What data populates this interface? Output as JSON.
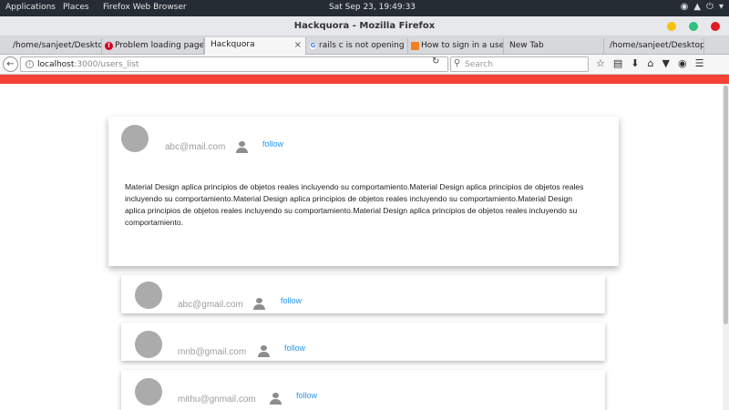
{
  "topbar": {
    "applications": "Applications",
    "places": "Places",
    "app_name": "Firefox Web Browser",
    "clock": "Sat Sep 23, 19:49:33",
    "icons": [
      "network-icon",
      "volume-icon",
      "power-icon",
      "chevron-down-icon"
    ]
  },
  "window": {
    "title": "Hackquora - Mozilla Firefox",
    "button_colors": [
      "#f5c211",
      "#2ec27e",
      "#e01b24"
    ]
  },
  "tabs": [
    {
      "label": "/home/sanjeet/Desktop/D",
      "favicon": "none"
    },
    {
      "label": "Problem loading page",
      "favicon": "error"
    },
    {
      "label": "Hackquora",
      "favicon": "none",
      "active": true
    },
    {
      "label": "rails c is not opening",
      "favicon": "google"
    },
    {
      "label": "How to sign in a user",
      "favicon": "stackoverflow"
    },
    {
      "label": "New Tab",
      "favicon": "none"
    },
    {
      "label": "/home/sanjeet/Desktop/D",
      "favicon": "none"
    }
  ],
  "navbar": {
    "url_host": "localhost",
    "url_path": ":3000/users_list",
    "search_placeholder": "Search"
  },
  "colors": {
    "accent_red": "#f44336",
    "link_blue": "#2196f3",
    "avatar_gray": "#ababab"
  },
  "main_card": {
    "email": "abc@mail.com",
    "follow_label": "follow",
    "description": "Material Design aplica principios de objetos reales incluyendo su comportamiento.Material Design aplica principios de objetos reales incluyendo su comportamiento.Material Design aplica principios de objetos reales incluyendo su comportamiento.Material Design aplica principios de objetos reales incluyendo su comportamiento.Material Design aplica principios de objetos reales incluyendo su comportamiento."
  },
  "users": [
    {
      "email": "abc@gmail.com",
      "follow_label": "follow"
    },
    {
      "email": "mnb@gmail.com",
      "follow_label": "follow"
    },
    {
      "email": "mithu@gnmail.com",
      "follow_label": "follow"
    }
  ]
}
